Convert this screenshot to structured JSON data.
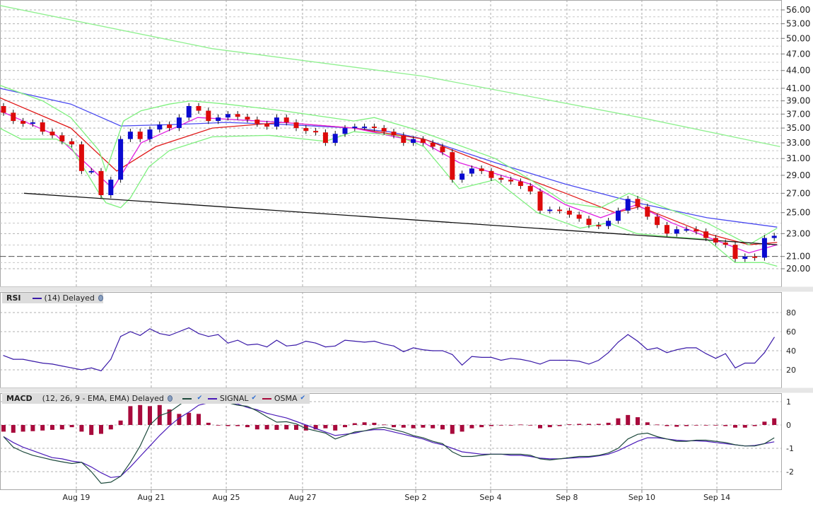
{
  "rsi_header": {
    "title": "RSI",
    "params": "(14) Delayed",
    "icon": "settings-icon"
  },
  "macd_header": {
    "title": "MACD",
    "params": "(12, 26, 9 - EMA, EMA) Delayed",
    "signal": "SIGNAL",
    "osma": "OSMA",
    "check": "✔"
  },
  "colors": {
    "up": "#0a0ad0",
    "down": "#dd0a0a",
    "ma_long": "#8ff08f",
    "ma_blue": "#4a4af0",
    "ma_red": "#e01a1a",
    "ma_magenta": "#e020e0",
    "bollinger": "#7ef07e",
    "rsi": "#3a1aa8",
    "macd": "#1d4a3c",
    "signal": "#4a1ab8",
    "osma": "#a80a3c"
  },
  "chart_data": {
    "type": "candlestick",
    "x_ticks": [
      {
        "label": "Aug 19",
        "index": 7.46
      },
      {
        "label": "Aug 21",
        "index": 15.14
      },
      {
        "label": "Aug 25",
        "index": 22.83
      },
      {
        "label": "Aug 27",
        "index": 30.65
      },
      {
        "label": "Sep 2",
        "index": 42.25
      },
      {
        "label": "Sep 4",
        "index": 49.93
      },
      {
        "label": "Sep 8",
        "index": 57.75
      },
      {
        "label": "Sep 10",
        "index": 65.43
      },
      {
        "label": "Sep 14",
        "index": 73.12
      }
    ],
    "price": {
      "scale": "log",
      "ylim": [
        18.9,
        58.5
      ],
      "ticks": [
        "56.00",
        "53.00",
        "50.00",
        "47.00",
        "44.00",
        "41.00",
        "39.00",
        "37.00",
        "35.00",
        "33.00",
        "31.00",
        "29.00",
        "27.00",
        "25.00",
        "23.00",
        "21.00",
        "20.00"
      ],
      "open": [
        38.2,
        37.2,
        36,
        35.6,
        35.8,
        34.5,
        34,
        33.2,
        32.8,
        29.5,
        29.5,
        26.8,
        28.5,
        33.5,
        34.5,
        33.5,
        34.8,
        35.5,
        35,
        36.5,
        38.2,
        37.5,
        36,
        36.5,
        37,
        36.6,
        36.2,
        35.6,
        35.2,
        36.5,
        35.8,
        35,
        34.6,
        34.4,
        33,
        34.2,
        35,
        35.2,
        35.2,
        35,
        34.5,
        34,
        33,
        33.5,
        33,
        32.5,
        31.8,
        28.5,
        29.2,
        29.8,
        29.5,
        28.7,
        28.5,
        28.3,
        27.8,
        27.2,
        25.2,
        25.3,
        25.2,
        24.8,
        24.4,
        23.8,
        23.7,
        24.2,
        25.2,
        26.4,
        25.6,
        24.6,
        23.8,
        23,
        23.4,
        23.4,
        23.2,
        22.6,
        22.2,
        22,
        20.8,
        21,
        20.9,
        22.6
      ],
      "close": [
        37.2,
        36,
        35.6,
        35.8,
        34.5,
        34,
        33.2,
        32.8,
        29.5,
        29.5,
        26.8,
        28.5,
        33.5,
        34.5,
        33.5,
        34.8,
        35.5,
        35,
        36.5,
        38.2,
        37.5,
        36,
        36.5,
        37,
        36.6,
        36.2,
        35.6,
        35.2,
        36.5,
        35.8,
        35,
        34.6,
        34.4,
        33,
        34.2,
        35,
        35.2,
        35.2,
        35,
        34.5,
        34,
        33,
        33.5,
        33,
        32.5,
        31.8,
        28.5,
        29.2,
        29.8,
        29.5,
        28.7,
        28.5,
        28.3,
        27.8,
        27.2,
        25.2,
        25.3,
        25.2,
        24.8,
        24.4,
        23.8,
        23.7,
        24.2,
        25.2,
        26.4,
        25.6,
        24.6,
        23.8,
        23,
        23.4,
        23.4,
        23.2,
        22.6,
        22.2,
        22,
        20.8,
        21,
        20.9,
        22.6,
        22.8
      ],
      "overlays": [
        {
          "name": "ma-long",
          "color_key": "ma_long",
          "points": [
            [
              -0.4,
              57
            ],
            [
              21.4,
              48
            ],
            [
              43.1,
              43
            ],
            [
              64.9,
              36.6
            ],
            [
              79.6,
              32.5
            ]
          ]
        },
        {
          "name": "ma-blue",
          "color_key": "ma_blue",
          "points": [
            [
              -0.4,
              41
            ],
            [
              6.9,
              38.5
            ],
            [
              12,
              35.3
            ],
            [
              17.8,
              35.5
            ],
            [
              22.8,
              35.8
            ],
            [
              28.6,
              35.5
            ],
            [
              35.9,
              35
            ],
            [
              39.5,
              34.5
            ],
            [
              43.1,
              33.5
            ],
            [
              50.4,
              30.5
            ],
            [
              57.6,
              28
            ],
            [
              64.9,
              26
            ],
            [
              72.1,
              24.5
            ],
            [
              79.3,
              23.6
            ]
          ]
        },
        {
          "name": "ma-red",
          "color_key": "ma_red",
          "points": [
            [
              -0.4,
              39.5
            ],
            [
              6.9,
              35
            ],
            [
              11.6,
              29.5
            ],
            [
              15.6,
              32.5
            ],
            [
              21.4,
              35
            ],
            [
              28.6,
              35.8
            ],
            [
              35.9,
              35
            ],
            [
              43.1,
              33.5
            ],
            [
              50.4,
              30
            ],
            [
              57.6,
              27
            ],
            [
              62.7,
              25
            ],
            [
              65.2,
              25.6
            ],
            [
              72.1,
              23
            ],
            [
              76.4,
              22
            ],
            [
              79.3,
              22.2
            ]
          ]
        },
        {
          "name": "ma-magenta",
          "color_key": "ma_magenta",
          "points": [
            [
              -0.4,
              37.5
            ],
            [
              5.4,
              34
            ],
            [
              11.2,
              27.5
            ],
            [
              14.1,
              33
            ],
            [
              19.9,
              36.5
            ],
            [
              28.6,
              35.8
            ],
            [
              35.9,
              35
            ],
            [
              43.1,
              33
            ],
            [
              46.7,
              30.5
            ],
            [
              54,
              28
            ],
            [
              57.6,
              25.8
            ],
            [
              61.2,
              24.5
            ],
            [
              64.9,
              25.8
            ],
            [
              68.5,
              24
            ],
            [
              72.1,
              22.7
            ],
            [
              76.4,
              21.3
            ],
            [
              79.3,
              22
            ]
          ]
        },
        {
          "name": "bollinger-upper",
          "color_key": "bollinger",
          "points": [
            [
              -0.4,
              41.5
            ],
            [
              4,
              39
            ],
            [
              6.9,
              36.5
            ],
            [
              9.8,
              32
            ],
            [
              10.5,
              29.5
            ],
            [
              12.3,
              36
            ],
            [
              14.1,
              37.5
            ],
            [
              17,
              38.5
            ],
            [
              19.2,
              39
            ],
            [
              22.8,
              38.5
            ],
            [
              28.6,
              37.5
            ],
            [
              35.9,
              36
            ],
            [
              38,
              36.5
            ],
            [
              41.7,
              35
            ],
            [
              46,
              33
            ],
            [
              50.4,
              31
            ],
            [
              54,
              28.5
            ],
            [
              57.6,
              26
            ],
            [
              61.2,
              25.5
            ],
            [
              64.1,
              27
            ],
            [
              67.8,
              25.5
            ],
            [
              72.1,
              24
            ],
            [
              76.4,
              22
            ],
            [
              79.3,
              23.5
            ]
          ]
        },
        {
          "name": "bollinger-lower",
          "color_key": "bollinger",
          "points": [
            [
              -0.4,
              35
            ],
            [
              1.8,
              33.5
            ],
            [
              5.4,
              33.5
            ],
            [
              6.9,
              32.5
            ],
            [
              9.8,
              27
            ],
            [
              10.5,
              26
            ],
            [
              12,
              25.5
            ],
            [
              13,
              26.5
            ],
            [
              14.9,
              30
            ],
            [
              17,
              32
            ],
            [
              21.4,
              33.8
            ],
            [
              27.2,
              34
            ],
            [
              33,
              33.2
            ],
            [
              35.9,
              34.5
            ],
            [
              40.2,
              34
            ],
            [
              43.1,
              32.5
            ],
            [
              46.7,
              27.5
            ],
            [
              50.4,
              28.5
            ],
            [
              54.7,
              25
            ],
            [
              59.1,
              23.5
            ],
            [
              62,
              24
            ],
            [
              64.9,
              23
            ],
            [
              68.5,
              22.7
            ],
            [
              72.1,
              22.5
            ],
            [
              75,
              20.5
            ],
            [
              77.9,
              20.5
            ],
            [
              79.3,
              20.2
            ]
          ]
        }
      ],
      "trendline": [
        [
          2.1,
          27.0
        ],
        [
          79.3,
          22.0
        ]
      ],
      "reference_level": 21.0
    },
    "rsi": {
      "ylim": [
        0,
        100
      ],
      "ticks": [
        80,
        60,
        40,
        20
      ],
      "values": [
        35,
        31,
        31,
        29,
        27,
        26,
        24,
        22,
        20,
        22,
        19,
        31,
        55,
        60,
        56,
        63,
        58,
        56,
        60,
        64,
        58,
        55,
        57,
        48,
        51,
        46,
        47,
        44,
        51,
        45,
        46,
        50,
        48,
        44,
        45,
        51,
        50,
        49,
        50,
        47,
        45,
        39,
        43,
        41,
        40,
        40,
        36,
        25,
        34,
        33,
        33,
        30,
        32,
        31,
        29,
        26,
        30,
        30,
        30,
        29,
        26,
        30,
        38,
        49,
        57,
        50,
        41,
        43,
        38,
        41,
        43,
        43,
        37,
        32,
        37,
        22,
        27,
        27,
        38,
        54
      ]
    },
    "macd": {
      "ylim": [
        -2.7,
        1.4
      ],
      "ticks": [
        1,
        0,
        -1,
        -2
      ],
      "macd": [
        -0.5,
        -0.95,
        -1.15,
        -1.3,
        -1.4,
        -1.5,
        -1.58,
        -1.65,
        -1.6,
        -2.0,
        -2.5,
        -2.45,
        -2.2,
        -1.6,
        -0.9,
        0.0,
        0.4,
        0.55,
        0.85,
        1.15,
        1.2,
        1.05,
        1.0,
        0.95,
        0.85,
        0.8,
        0.6,
        0.35,
        0.12,
        0.14,
        0.05,
        -0.15,
        -0.25,
        -0.35,
        -0.6,
        -0.45,
        -0.3,
        -0.25,
        -0.15,
        -0.1,
        -0.2,
        -0.3,
        -0.45,
        -0.55,
        -0.7,
        -0.8,
        -1.15,
        -1.35,
        -1.35,
        -1.3,
        -1.25,
        -1.25,
        -1.25,
        -1.25,
        -1.3,
        -1.45,
        -1.5,
        -1.45,
        -1.4,
        -1.35,
        -1.35,
        -1.3,
        -1.2,
        -1.0,
        -0.6,
        -0.4,
        -0.35,
        -0.5,
        -0.6,
        -0.7,
        -0.7,
        -0.65,
        -0.65,
        -0.7,
        -0.75,
        -0.85,
        -0.9,
        -0.9,
        -0.8,
        -0.55
      ],
      "signal": [
        -0.5,
        -0.75,
        -0.95,
        -1.1,
        -1.25,
        -1.4,
        -1.45,
        -1.55,
        -1.6,
        -1.8,
        -2.05,
        -2.25,
        -2.2,
        -1.8,
        -1.35,
        -0.9,
        -0.45,
        -0.05,
        0.3,
        0.55,
        0.85,
        0.95,
        0.95,
        0.95,
        0.9,
        0.75,
        0.65,
        0.5,
        0.4,
        0.3,
        0.15,
        0.0,
        -0.15,
        -0.3,
        -0.45,
        -0.4,
        -0.35,
        -0.25,
        -0.2,
        -0.2,
        -0.3,
        -0.4,
        -0.5,
        -0.6,
        -0.75,
        -0.85,
        -1.0,
        -1.15,
        -1.2,
        -1.25,
        -1.25,
        -1.25,
        -1.3,
        -1.3,
        -1.35,
        -1.42,
        -1.45,
        -1.45,
        -1.42,
        -1.4,
        -1.38,
        -1.32,
        -1.25,
        -1.1,
        -0.9,
        -0.7,
        -0.55,
        -0.55,
        -0.6,
        -0.65,
        -0.68,
        -0.68,
        -0.7,
        -0.75,
        -0.8,
        -0.85,
        -0.9,
        -0.88,
        -0.8,
        -0.72
      ],
      "osma": [
        -0.3,
        -0.35,
        -0.3,
        -0.28,
        -0.25,
        -0.22,
        -0.2,
        -0.1,
        -0.3,
        -0.45,
        -0.4,
        -0.2,
        0.2,
        0.85,
        0.9,
        0.85,
        0.9,
        0.7,
        0.5,
        0.55,
        0.5,
        0.1,
        0.0,
        -0.05,
        -0.05,
        -0.1,
        -0.2,
        -0.2,
        -0.22,
        -0.2,
        -0.22,
        -0.25,
        -0.2,
        -0.15,
        -0.25,
        -0.1,
        0.08,
        0.12,
        0.1,
        0.02,
        -0.1,
        -0.12,
        -0.15,
        -0.12,
        -0.15,
        -0.2,
        -0.4,
        -0.3,
        -0.15,
        -0.1,
        -0.05,
        0.0,
        0.0,
        0.02,
        0.0,
        -0.15,
        -0.1,
        -0.05,
        0.03,
        0.05,
        0.05,
        0.05,
        0.1,
        0.3,
        0.45,
        0.35,
        0.12,
        0.02,
        -0.05,
        -0.08,
        -0.05,
        -0.02,
        0.0,
        -0.02,
        -0.05,
        -0.12,
        -0.12,
        -0.05,
        0.15,
        0.3
      ]
    }
  }
}
